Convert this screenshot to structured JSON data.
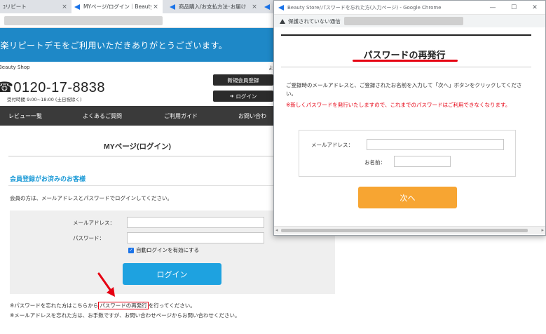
{
  "browser": {
    "tabs": [
      {
        "title": "ｺリピート"
      },
      {
        "title": "MYページ/ログイン｜Beauty S"
      },
      {
        "title": "商品購入/お支払方法･お届け"
      },
      {
        "title": ""
      }
    ],
    "tab_close": "×"
  },
  "page": {
    "banner": "楽楽リピートデモをご利用いただきありがとうございます。",
    "shop_name": "Beauty Shop",
    "shop_name_right": "よ",
    "phone": "0120-17-8838",
    "phone_prefix": "☎",
    "phone_hours": "受付時間 9:00~18:00 (土日祝除く)",
    "register_button": "新規会員登録",
    "login_header_button": "ログイン",
    "nav": [
      "レビュー一覧",
      "よくあるご質問",
      "ご利用ガイド",
      "お問い合わ"
    ],
    "mypage_title": "MYページ(ログイン)",
    "member_heading": "会員登録がお済みのお客様",
    "member_lead": "会員の方は、メールアドレスとパスワードでログインしてください。",
    "email_label": "メールアドレス：",
    "password_label": "パスワード：",
    "autologin_label": "自動ログインを有効にする",
    "login_button": "ログイン",
    "note_forgot_pre": "※パスワードを忘れた方はこちらから",
    "note_forgot_link": "パスワードの再発行",
    "note_forgot_post": "を行ってください。",
    "note_email": "※メールアドレスを忘れた方は、お手数ですが、お問い合わせページからお問い合わせください。"
  },
  "popup": {
    "title": "Beauty Store/パスワードを忘れた方(入力ページ) - Google Chrome",
    "insecure_label": "保護されていない通信",
    "controls": {
      "minimize": "—",
      "maximize": "☐",
      "close": "✕"
    },
    "heading": "パスワードの再発行",
    "description": "ご登録時のメールアドレスと、ご登録されたお名前を入力して「次へ」ボタンをクリックしてください。",
    "warning": "※新しくパスワードを発行いたしますので、これまでのパスワードはご利用できなくなります。",
    "email_label": "メールアドレス：",
    "name_label": "お名前：",
    "next_button": "次へ"
  },
  "colors": {
    "banner_bg": "#1e88c7",
    "accent_blue": "#1ea2e0",
    "accent_orange": "#f7a532",
    "highlight_red": "#e60012"
  },
  "icons": [
    "tab-favicon-icon",
    "tab-close-icon",
    "phone-icon",
    "login-icon",
    "checkbox-checked-icon",
    "insecure-warning-icon",
    "red-arrow-annotation-icon"
  ]
}
